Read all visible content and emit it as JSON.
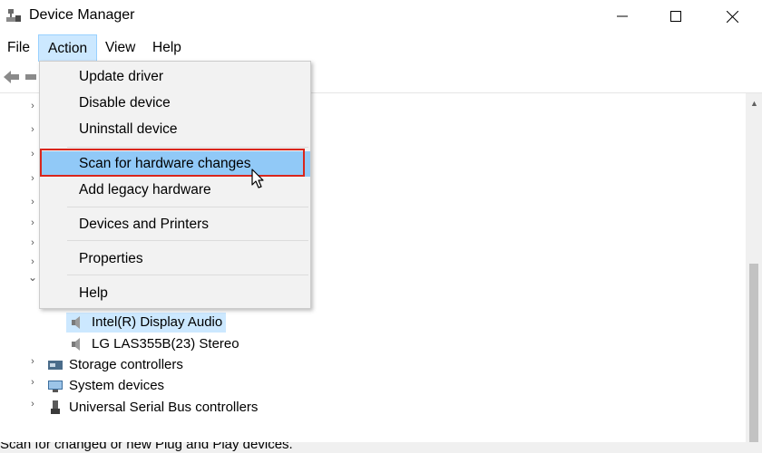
{
  "window": {
    "title": "Device Manager"
  },
  "menubar": {
    "items": [
      "File",
      "Action",
      "View",
      "Help"
    ]
  },
  "action_menu": {
    "items": [
      {
        "label": "Update driver"
      },
      {
        "label": "Disable device"
      },
      {
        "label": "Uninstall device"
      },
      {
        "label": "Scan for hardware changes",
        "highlighted": true
      },
      {
        "label": "Add legacy hardware"
      },
      {
        "label": "Devices and Printers"
      },
      {
        "label": "Properties"
      },
      {
        "label": "Help"
      }
    ]
  },
  "tree": {
    "audio_children": [
      "Intel(R) Display Audio",
      "LG LAS355B(23) Stereo"
    ],
    "categories": [
      "Storage controllers",
      "System devices",
      "Universal Serial Bus controllers"
    ]
  },
  "status_bar": {
    "text": "Scan for changed or new Plug and Play devices."
  },
  "colors": {
    "menu_highlight": "#91c9f7",
    "selection": "#cce8ff",
    "callout_border": "#d9261c"
  }
}
